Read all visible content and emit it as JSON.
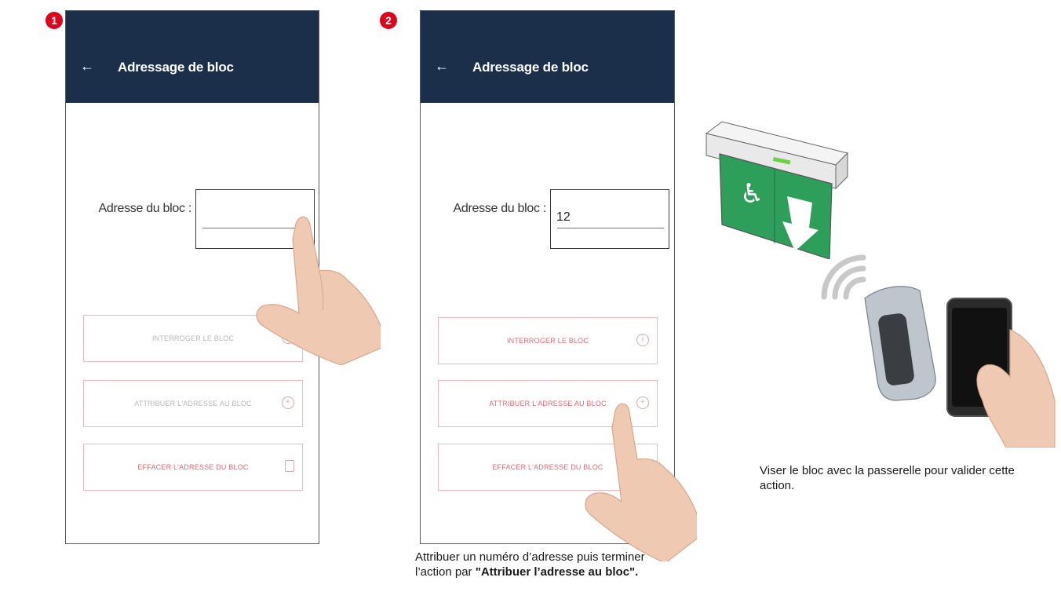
{
  "steps": [
    "1",
    "2"
  ],
  "screens": [
    {
      "title": "Adressage de bloc",
      "field_label": "Adresse du bloc :",
      "field_value": "",
      "buttons": [
        {
          "label": "INTERROGER LE BLOC",
          "icon": "info-icon"
        },
        {
          "label": "ATTRIBUER L'ADRESSE AU BLOC",
          "icon": "plus-circle-icon"
        },
        {
          "label": "EFFACER L'ADRESSE DU BLOC",
          "icon": "trash-icon"
        }
      ]
    },
    {
      "title": "Adressage de bloc",
      "field_label": "Adresse du bloc :",
      "field_value": "12",
      "buttons": [
        {
          "label": "INTERROGER LE BLOC",
          "icon": "info-icon"
        },
        {
          "label": "ATTRIBUER L'ADRESSE AU BLOC",
          "icon": "plus-circle-icon"
        },
        {
          "label": "EFFACER L'ADRESSE DU BLOC",
          "icon": "trash-icon"
        }
      ]
    }
  ],
  "captions": {
    "step2_text": "Attribuer un numéro d’adresse puis terminer l’action par ",
    "step2_bold": "\"Attribuer l’adresse au bloc\".",
    "step3_text": "Viser le bloc avec la passerelle pour valider cette action."
  },
  "colors": {
    "appbar": "#1b2f4a",
    "accent_red": "#e1001a",
    "button_border": "#f0b8bc",
    "exit_sign_green": "#2e9e5b"
  }
}
